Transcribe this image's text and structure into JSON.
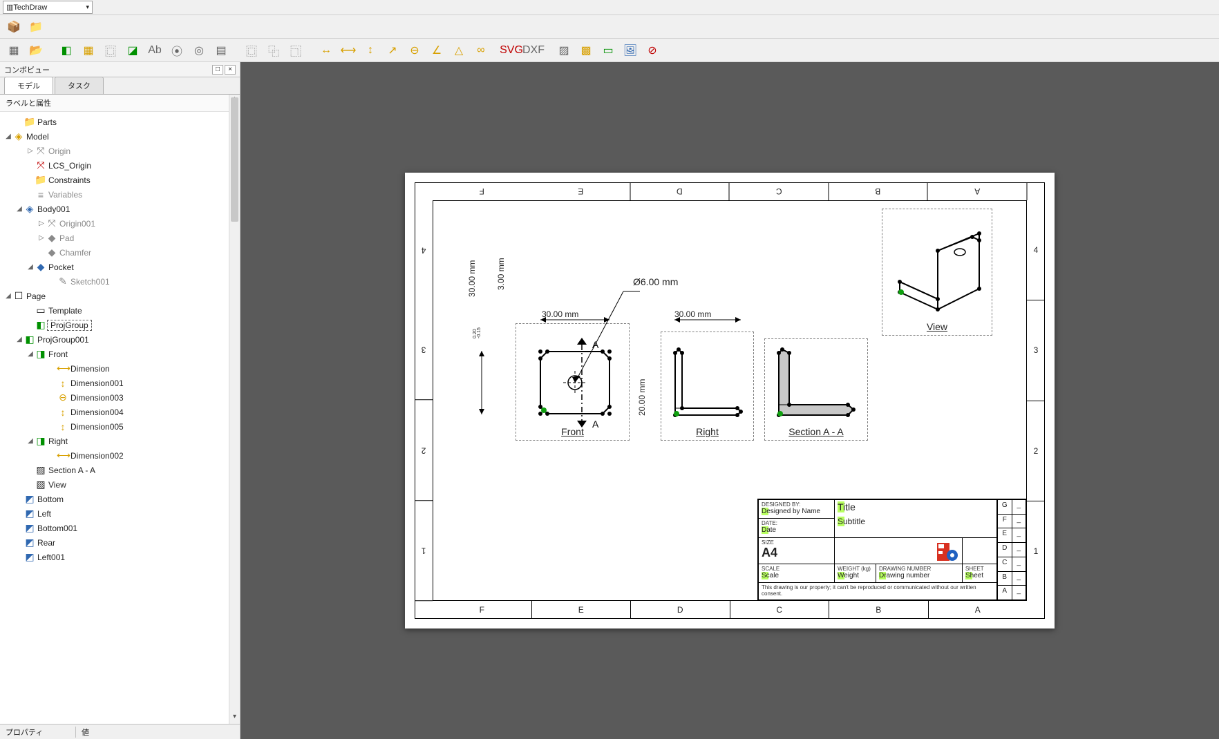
{
  "wb_selector": {
    "label": "TechDraw"
  },
  "toolbar1": [
    {
      "name": "part-icon",
      "glyph": "📦",
      "cls": "ic-yellow"
    },
    {
      "name": "folder-icon",
      "glyph": "📁",
      "cls": "ic-blue"
    }
  ],
  "toolbar2_groups": [
    [
      {
        "name": "new-page-icon",
        "glyph": "▦",
        "cls": "ic-grey"
      },
      {
        "name": "open-folder-icon",
        "glyph": "📂",
        "cls": "ic-orange"
      }
    ],
    [
      {
        "name": "insert-view-icon",
        "glyph": "◧",
        "cls": "ic-green"
      },
      {
        "name": "multi-view-icon",
        "glyph": "▦",
        "cls": "ic-yellow"
      },
      {
        "name": "section-view-icon",
        "glyph": "⿴",
        "cls": "ic-grey"
      },
      {
        "name": "proj-group-icon",
        "glyph": "◪",
        "cls": "ic-green"
      },
      {
        "name": "annotation-icon",
        "glyph": "Ab",
        "cls": "ic-grey"
      },
      {
        "name": "symbol-icon",
        "glyph": "⦿",
        "cls": "ic-grey"
      },
      {
        "name": "clip-icon",
        "glyph": "◎",
        "cls": "ic-grey"
      },
      {
        "name": "spreadsheet-icon",
        "glyph": "▤",
        "cls": "ic-grey"
      }
    ],
    [
      {
        "name": "clip-group-icon",
        "glyph": "⿴",
        "cls": "ic-grey"
      },
      {
        "name": "clip-add-icon",
        "glyph": "⿻",
        "cls": "ic-grey"
      },
      {
        "name": "clip-remove-icon",
        "glyph": "⿹",
        "cls": "ic-grey"
      }
    ],
    [
      {
        "name": "dim-length-icon",
        "glyph": "↔",
        "cls": "ic-yellow"
      },
      {
        "name": "dim-horizontal-icon",
        "glyph": "⟷",
        "cls": "ic-yellow"
      },
      {
        "name": "dim-vertical-icon",
        "glyph": "↕",
        "cls": "ic-yellow"
      },
      {
        "name": "dim-radius-icon",
        "glyph": "↗",
        "cls": "ic-yellow"
      },
      {
        "name": "dim-diameter-icon",
        "glyph": "⊖",
        "cls": "ic-yellow"
      },
      {
        "name": "dim-angle-icon",
        "glyph": "∠",
        "cls": "ic-yellow"
      },
      {
        "name": "dim-3pt-angle-icon",
        "glyph": "△",
        "cls": "ic-yellow"
      },
      {
        "name": "dim-link-icon",
        "glyph": "∞",
        "cls": "ic-yellow"
      }
    ],
    [
      {
        "name": "export-svg-icon",
        "glyph": "SVG",
        "cls": "ic-red"
      },
      {
        "name": "export-dxf-icon",
        "glyph": "DXF",
        "cls": "ic-grey"
      }
    ],
    [
      {
        "name": "hatch-icon",
        "glyph": "▨",
        "cls": "ic-grey"
      },
      {
        "name": "geom-hatch-icon",
        "glyph": "▩",
        "cls": "ic-yellow"
      },
      {
        "name": "toggle-frame-icon",
        "glyph": "▭",
        "cls": "ic-green"
      },
      {
        "name": "image-icon",
        "glyph": "🖼",
        "cls": "ic-blue"
      },
      {
        "name": "remove-icon",
        "glyph": "⊘",
        "cls": "ic-red"
      }
    ]
  ],
  "combo_panel": {
    "title": "コンボビュー",
    "tabs": {
      "model": "モデル",
      "task": "タスク"
    },
    "header": "ラベルと属性",
    "prop_label": "プロパティ",
    "prop_value": "値"
  },
  "tree": [
    {
      "ind": 1,
      "ic": "📁",
      "lbl": "Parts",
      "cls": "ic-blue"
    },
    {
      "ind": 0,
      "tog": "◢",
      "ic": "◈",
      "lbl": "Model",
      "cls": "ic-yellow"
    },
    {
      "ind": 2,
      "tog": "▷",
      "ic": "⤧",
      "lbl": "Origin",
      "grey": true
    },
    {
      "ind": 2,
      "ic": "⤧",
      "lbl": "LCS_Origin",
      "cls": "ic-red"
    },
    {
      "ind": 2,
      "ic": "📁",
      "lbl": "Constraints",
      "cls": "ic-blue"
    },
    {
      "ind": 2,
      "ic": "≡",
      "lbl": "Variables",
      "grey": true
    },
    {
      "ind": 1,
      "tog": "◢",
      "ic": "◈",
      "lbl": "Body001",
      "cls": "ic-blue"
    },
    {
      "ind": 3,
      "tog": "▷",
      "ic": "⤧",
      "lbl": "Origin001",
      "grey": true
    },
    {
      "ind": 3,
      "tog": "▷",
      "ic": "◆",
      "lbl": "Pad",
      "grey": true
    },
    {
      "ind": 3,
      "ic": "◆",
      "lbl": "Chamfer",
      "grey": true
    },
    {
      "ind": 2,
      "tog": "◢",
      "ic": "◆",
      "lbl": "Pocket",
      "cls": "ic-blue"
    },
    {
      "ind": 4,
      "ic": "✎",
      "lbl": "Sketch001",
      "grey": true
    },
    {
      "ind": 0,
      "tog": "◢",
      "ic": "☐",
      "lbl": "Page"
    },
    {
      "ind": 2,
      "ic": "▭",
      "lbl": "Template"
    },
    {
      "ind": 2,
      "ic": "◧",
      "lbl": "ProjGroup",
      "sel": true,
      "cls": "ic-green"
    },
    {
      "ind": 1,
      "tog": "◢",
      "ic": "◧",
      "lbl": "ProjGroup001",
      "cls": "ic-green"
    },
    {
      "ind": 2,
      "tog": "◢",
      "ic": "◨",
      "lbl": "Front",
      "cls": "ic-green"
    },
    {
      "ind": 4,
      "ic": "⟷",
      "lbl": "Dimension",
      "cls": "ic-yellow"
    },
    {
      "ind": 4,
      "ic": "↕",
      "lbl": "Dimension001",
      "cls": "ic-yellow"
    },
    {
      "ind": 4,
      "ic": "⊖",
      "lbl": "Dimension003",
      "cls": "ic-yellow"
    },
    {
      "ind": 4,
      "ic": "↕",
      "lbl": "Dimension004",
      "cls": "ic-yellow"
    },
    {
      "ind": 4,
      "ic": "↕",
      "lbl": "Dimension005",
      "cls": "ic-yellow"
    },
    {
      "ind": 2,
      "tog": "◢",
      "ic": "◨",
      "lbl": "Right",
      "cls": "ic-green"
    },
    {
      "ind": 4,
      "ic": "⟷",
      "lbl": "Dimension002",
      "cls": "ic-yellow"
    },
    {
      "ind": 2,
      "ic": "▨",
      "lbl": "Section A - A"
    },
    {
      "ind": 2,
      "ic": "▨",
      "lbl": "View"
    },
    {
      "ind": 1,
      "ic": "◩",
      "lbl": "Bottom",
      "cls": "ic-blue"
    },
    {
      "ind": 1,
      "ic": "◩",
      "lbl": "Left",
      "cls": "ic-blue"
    },
    {
      "ind": 1,
      "ic": "◩",
      "lbl": "Bottom001",
      "cls": "ic-blue"
    },
    {
      "ind": 1,
      "ic": "◩",
      "lbl": "Rear",
      "cls": "ic-blue"
    },
    {
      "ind": 1,
      "ic": "◩",
      "lbl": "Left001",
      "cls": "ic-blue"
    }
  ],
  "sheet": {
    "cols": [
      "F",
      "E",
      "D",
      "C",
      "B",
      "A"
    ],
    "cols_bot": [
      "F",
      "E",
      "D",
      "C",
      "B",
      "A"
    ],
    "rows": [
      "4",
      "3",
      "2",
      "1"
    ]
  },
  "views": {
    "front": {
      "label": "Front",
      "dims": {
        "w": "30.00 mm",
        "h": "30.00 mm",
        "t": "3.00 mm",
        "dia": "Ø6.00 mm",
        "tol_hi": "0.20",
        "tol_lo": "-0.15",
        "h2": "20.00 mm"
      },
      "section_letter": "A"
    },
    "right": {
      "label": "Right",
      "dims": {
        "w": "30.00 mm"
      }
    },
    "section": {
      "label": "Section A - A"
    },
    "iso": {
      "label": "View"
    }
  },
  "titleblock": {
    "designed_by_lbl": "DESIGNED BY:",
    "designed_by": "Designed by Name",
    "date_lbl": "DATE:",
    "date": "Date",
    "size_lbl": "SIZE",
    "size": "A4",
    "title_lbl": "Title",
    "subtitle": "Subtitle",
    "scale_lbl": "SCALE",
    "scale": "Scale",
    "weight_lbl": "WEIGHT (kg)",
    "weight": "Weight",
    "drawno_lbl": "DRAWING NUMBER",
    "drawno": "Drawing number",
    "sheet_lbl": "SHEET",
    "sheet": "Sheet",
    "footer": "This drawing is our property; it can't be reproduced or communicated without our written consent.",
    "rev_letters": [
      "G",
      "F",
      "E",
      "D",
      "C",
      "B",
      "A"
    ],
    "rev_dash": "_"
  }
}
